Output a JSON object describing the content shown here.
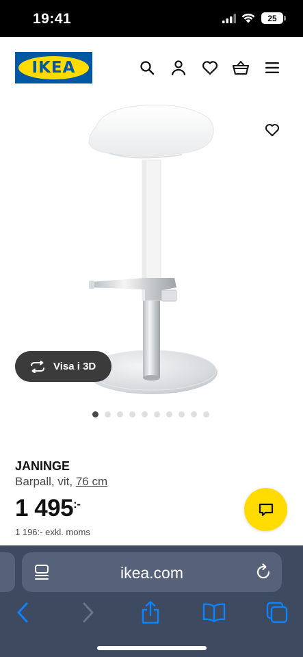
{
  "status_bar": {
    "time": "19:41",
    "battery": "25"
  },
  "header": {
    "logo_text": "IKEA",
    "icons": [
      "search-icon",
      "account-icon",
      "heart-icon",
      "basket-icon",
      "menu-icon"
    ]
  },
  "product": {
    "gallery": {
      "slide_count": 10,
      "active_index": 0,
      "view3d_label": "Visa i 3D"
    },
    "name": "JANINGE",
    "description": "Barpall, vit,",
    "size": "76 cm",
    "price_main": "1 495",
    "price_suffix": ":-",
    "price_ex_vat": "1 196:- exkl. moms"
  },
  "browser": {
    "url": "ikea.com"
  },
  "colors": {
    "ikea_blue": "#0058a3",
    "ikea_yellow": "#ffdb00",
    "safari_bar": "#3d4a5f",
    "ios_blue": "#0a84ff"
  }
}
